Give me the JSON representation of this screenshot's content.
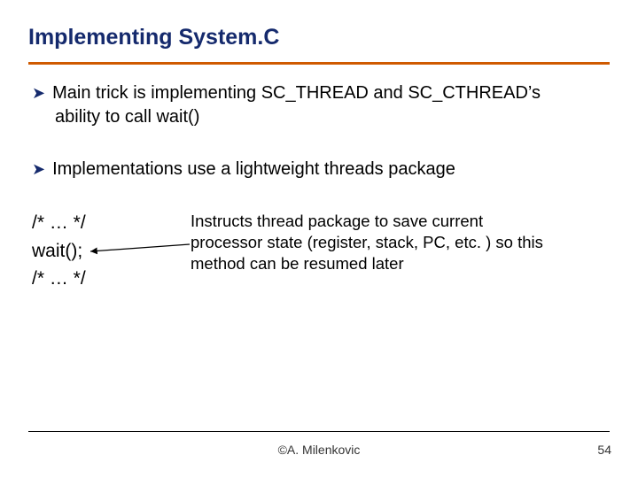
{
  "title": "Implementing System.C",
  "bullets": {
    "b1_line1": "Main trick is implementing SC_THREAD and SC_CTHREAD’s",
    "b1_line2": "ability to call wait()",
    "b2": "Implementations use a lightweight threads package"
  },
  "code": {
    "line1": "/* … */",
    "line2": "wait();",
    "line3": "/* … */"
  },
  "annotation": "Instructs thread package to save current processor state (register, stack, PC, etc. ) so this method can be resumed later",
  "footer": {
    "center": "©A. Milenkovic",
    "page": "54"
  },
  "glyphs": {
    "bullet_arrow": "➤"
  }
}
